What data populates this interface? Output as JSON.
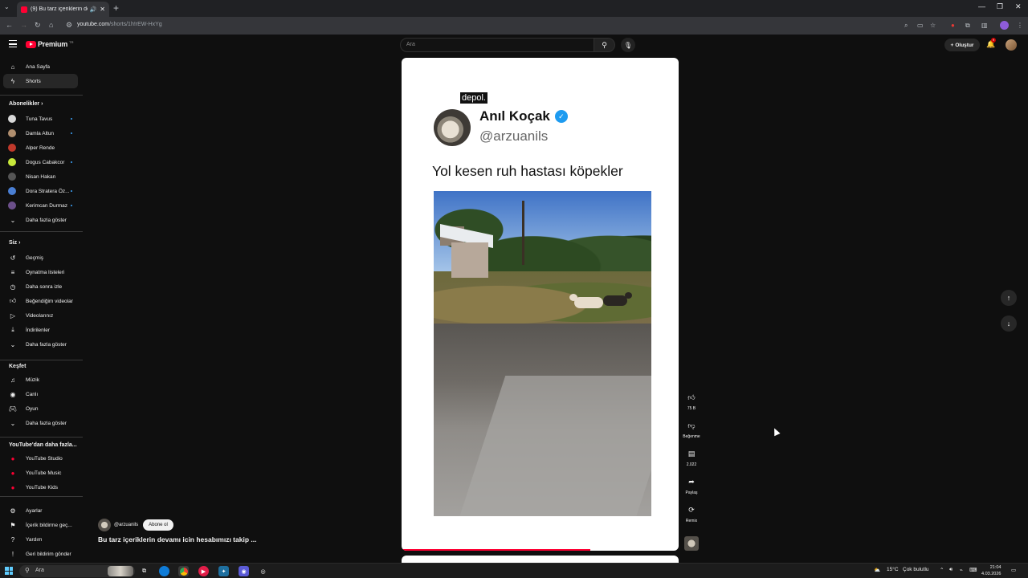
{
  "browser": {
    "tab_title": "(9) Bu tarz içeriklerin devamı",
    "url_host": "youtube.com",
    "url_path": "/shorts/1h!rEW-HxYg"
  },
  "header": {
    "logo_text": "Premium",
    "logo_region": "TR",
    "search_placeholder": "Ara",
    "create_label": "Oluştur",
    "notif_count": "9"
  },
  "sidebar": {
    "home": "Ana Sayfa",
    "shorts": "Shorts",
    "subs_header": "Abonelikler",
    "subscriptions": [
      {
        "name": "Tuna Tavus",
        "color": "#d8d8d8",
        "dot": true
      },
      {
        "name": "Damla Altun",
        "color": "#b08e6e",
        "dot": true
      },
      {
        "name": "Alper Rende",
        "color": "#c0392b",
        "dot": false
      },
      {
        "name": "Dogus Cabakcor",
        "color": "#c7e83a",
        "dot": true
      },
      {
        "name": "Nisan Hakan",
        "color": "#555555",
        "dot": false
      },
      {
        "name": "Dora Stratera Öz...",
        "color": "#4a7fd4",
        "dot": true
      },
      {
        "name": "Kerimcan Durmaz",
        "color": "#6b4f8a",
        "dot": true
      }
    ],
    "subs_more": "Daha fazla göster",
    "you_header": "Siz",
    "you_items": [
      "Geçmiş",
      "Oynatma listeleri",
      "Daha sonra izle",
      "Beğendiğim videolar",
      "Videolarınız",
      "İndirilenler",
      "Daha fazla göster"
    ],
    "explore_header": "Keşfet",
    "explore_items": [
      "Müzik",
      "Canlı",
      "Oyun",
      "Daha fazla göster"
    ],
    "more_header": "YouTube'dan daha fazla...",
    "more_items": [
      "YouTube Studio",
      "YouTube Music",
      "YouTube Kids"
    ],
    "bottom_items": [
      "Ayarlar",
      "İçerik bildirme geç...",
      "Yardım",
      "Geri bildirim gönder"
    ]
  },
  "short": {
    "watermark": "depol.",
    "tweet_name": "Anıl Koçak",
    "tweet_handle": "@arzuanils",
    "tweet_text": "Yol kesen ruh hastası köpekler",
    "channel": "@arzuanils",
    "subscribe_label": "Abone ol",
    "caption": "Bu tarz içeriklerin devamı icin hesabımızı takip ...",
    "progress": 0.68
  },
  "actions": {
    "likes": "75 B",
    "dislike_label": "Beğenme",
    "comments": "2.022",
    "share_label": "Paylaş",
    "remix_label": "Remix"
  },
  "taskbar": {
    "search_placeholder": "Ara",
    "weather": "15°C",
    "weather_desc": "Çok bulutlu",
    "time": "21:04",
    "date": "4.03.2026"
  }
}
